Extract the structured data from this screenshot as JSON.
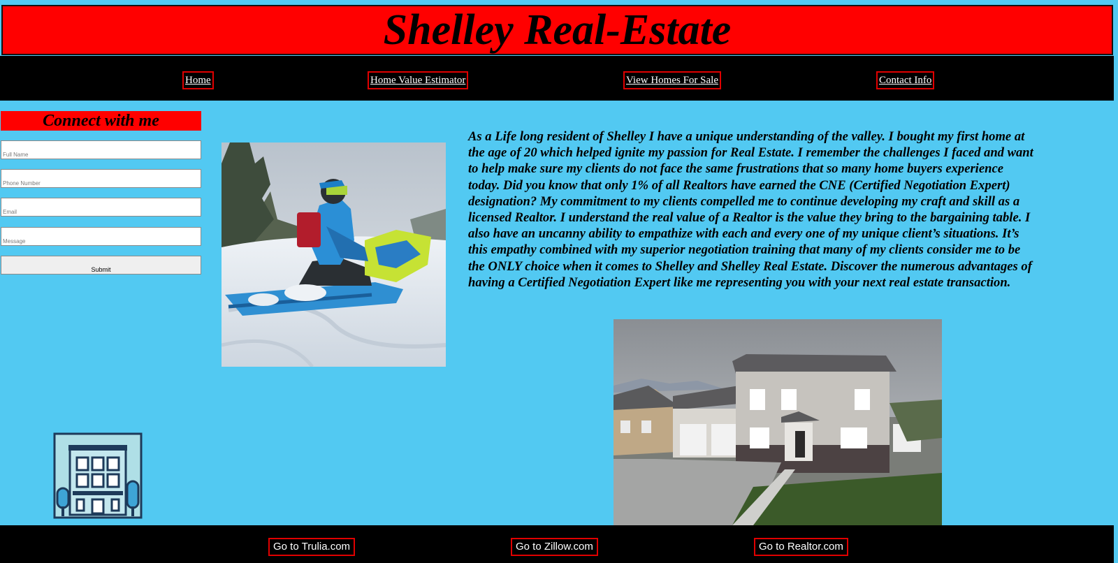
{
  "header": {
    "title": "Shelley Real-Estate"
  },
  "nav": {
    "items": [
      {
        "label": "Home"
      },
      {
        "label": "Home Value Estimator"
      },
      {
        "label": "View Homes For Sale"
      },
      {
        "label": "Contact Info"
      }
    ]
  },
  "contact_form": {
    "title": "Connect with me",
    "full_name_placeholder": "Full Name",
    "phone_placeholder": "Phone Number",
    "email_placeholder": "Email",
    "message_placeholder": "Message",
    "submit_label": "Submit"
  },
  "bio": {
    "text": "As a Life long resident of Shelley I have a unique understanding of the valley. I bought my first home at the age of 20 which helped ignite my passion for Real Estate. I remember the challenges I faced and want to help make sure my clients do not face the same frustrations that so many home buyers experience today. Did you know that only 1% of all Realtors have earned the CNE (Certified Negotiation Expert) designation? My commitment to my clients compelled me to continue developing my craft and skill as a licensed Realtor. I understand the real value of a Realtor is the value they bring to the bargaining table. I also have an uncanny ability to empathize with each and every one of my unique client’s situations. It’s this empathy combined with my superior negotiation training that many of my clients consider me to be the ONLY choice when it comes to Shelley and Shelley Real Estate. Discover the numerous advantages of having a Certified Negotiation Expert like me representing you with your next real estate transaction."
  },
  "images": {
    "snowmobile": "snowmobile-photo",
    "house": "house-photo",
    "building": "building-icon"
  },
  "footer": {
    "links": [
      {
        "label": "Go to Trulia.com"
      },
      {
        "label": "Go to Zillow.com"
      },
      {
        "label": "Go to Realtor.com"
      }
    ]
  },
  "colors": {
    "page_background": "#52c9f2",
    "header_background": "#ff0000",
    "nav_background": "#000000",
    "link_border": "#e00000"
  }
}
